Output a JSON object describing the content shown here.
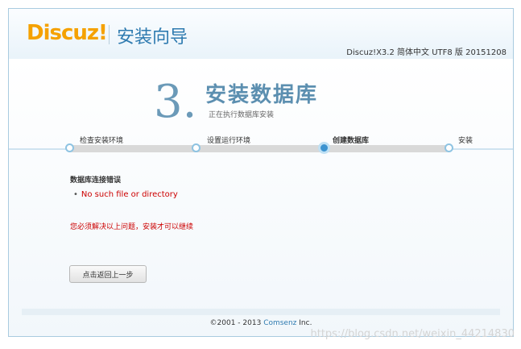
{
  "header": {
    "logo_text": "Discuz!",
    "wizard_title": "安装向导",
    "version": "Discuz!X3.2 简体中文 UTF8 版 20151208"
  },
  "step": {
    "number": "3.",
    "title": "安装数据库",
    "subtitle": "正在执行数据库安装"
  },
  "progress": {
    "steps": [
      {
        "label": "检查安装环境"
      },
      {
        "label": "设置运行环境"
      },
      {
        "label": "创建数据库"
      },
      {
        "label": "安装"
      }
    ],
    "current_index": 2
  },
  "error": {
    "title": "数据库连接错误",
    "items": [
      "No such file or directory"
    ],
    "must_fix": "您必须解决以上问题，安装才可以继续"
  },
  "buttons": {
    "back": "点击返回上一步"
  },
  "footer": {
    "copyright_prefix": "©2001 - 2013 ",
    "brand": "Comsenz",
    "suffix": " Inc."
  },
  "watermark": "https://blog.csdn.net/weixin_44214830",
  "colors": {
    "logo": "#f5a100",
    "accent": "#2f7bb0",
    "error": "#cc0000"
  }
}
